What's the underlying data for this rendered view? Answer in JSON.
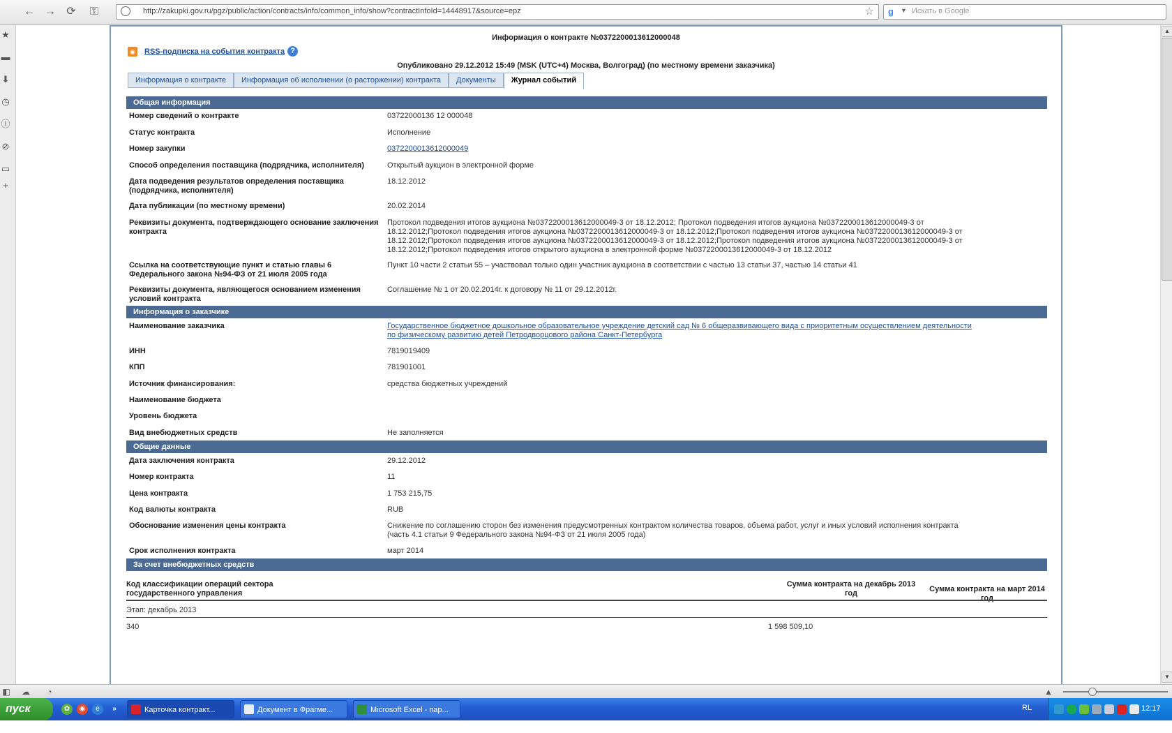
{
  "browser": {
    "url": "http://zakupki.gov.ru/pgz/public/action/contracts/info/common_info/show?contractInfoId=14448917&source=epz",
    "search_placeholder": "Искать в Google"
  },
  "page": {
    "title": "Информация о контракте №0372200013612000048",
    "rss_link": "RSS-подписка на события контракта",
    "rss_help": "?",
    "published": "Опубликовано 29.12.2012 15:49 (MSK (UTC+4) Москва, Волгоград) (по местному времени заказчика)",
    "tabs": [
      {
        "label": "Информация о контракте"
      },
      {
        "label": "Информация об исполнении (о расторжении) контракта"
      },
      {
        "label": "Документы"
      },
      {
        "label": "Журнал событий"
      }
    ]
  },
  "sections": {
    "general": {
      "header": "Общая информация",
      "rows": [
        {
          "label": "Номер сведений о контракте",
          "value": "03722000136 12 000048"
        },
        {
          "label": "Статус контракта",
          "value": "Исполнение"
        },
        {
          "label": "Номер закупки",
          "value": "0372200013612000049"
        },
        {
          "label": "Способ определения поставщика (подрядчика, исполнителя)",
          "value": "Открытый аукцион в электронной форме"
        },
        {
          "label": "Дата подведения результатов определения поставщика (подрядчика, исполнителя)",
          "value": "18.12.2012"
        },
        {
          "label": "Дата публикации (по местному времени)",
          "value": "20.02.2014"
        },
        {
          "label": "Реквизиты документа, подтверждающего основание заключения контракта",
          "value": "Протокол подведения итогов аукциона №0372200013612000049-3 от 18.12.2012; Протокол подведения итогов аукциона №0372200013612000049-3 от 18.12.2012;Протокол подведения итогов аукциона №0372200013612000049-3 от 18.12.2012;Протокол подведения итогов аукциона №0372200013612000049-3 от 18.12.2012;Протокол подведения итогов аукциона №0372200013612000049-3 от 18.12.2012;Протокол подведения итогов аукциона №0372200013612000049-3 от 18.12.2012;Протокол подведения итогов открытого аукциона в электронной форме №0372200013612000049-3 от 18.12.2012"
        },
        {
          "label": "Ссылка на соответствующие пункт и статью главы 6 Федерального закона №94-ФЗ от 21 июля 2005 года",
          "value": "Пункт 10 части 2 статьи 55 – участвовал только один участник аукциона в соответствии с частью 13 статьи 37, частью 14 статьи 41"
        },
        {
          "label": "Реквизиты документа, являющегося основанием изменения условий контракта",
          "value": "Соглашение № 1 от 20.02.2014г. к договору № 11 от 29.12.2012г."
        }
      ]
    },
    "customer": {
      "header": "Информация о заказчике",
      "rows": [
        {
          "label": "Наименование заказчика",
          "value": "Государственное бюджетное дошкольное образовательное учреждение детский сад № 6 общеразвивающего вида с приоритетным осуществлением деятельности по физическому развитию детей Петродворцового района Санкт-Петербурга"
        },
        {
          "label": "ИНН",
          "value": "7819019409"
        },
        {
          "label": "КПП",
          "value": "781901001"
        },
        {
          "label": "Источник финансирования:",
          "value": "средства бюджетных учреждений"
        },
        {
          "label": "Наименование бюджета",
          "value": ""
        },
        {
          "label": "Уровень бюджета",
          "value": ""
        },
        {
          "label": "Вид внебюджетных средств",
          "value": "Не заполняется"
        }
      ]
    },
    "common": {
      "header": "Общие данные",
      "rows": [
        {
          "label": "Дата заключения контракта",
          "value": "29.12.2012"
        },
        {
          "label": "Номер контракта",
          "value": "11"
        },
        {
          "label": "Цена контракта",
          "value": "1 753 215,75"
        },
        {
          "label": "Код валюты контракта",
          "value": "RUB"
        },
        {
          "label": "Обоснование изменения цены контракта",
          "value": "Снижение по соглашению сторон без изменения предусмотренных контрактом количества товаров, объема работ, услуг и иных условий исполнения контракта (часть 4.1 статьи 9 Федерального закона №94-ФЗ от 21 июля 2005 года)"
        },
        {
          "label": "Срок исполнения контракта",
          "value": "март 2014"
        }
      ]
    },
    "extrabudget": {
      "header": "За счет внебюджетных средств",
      "columns": [
        "Код классификации операций сектора государственного управления",
        "Сумма контракта на декабрь 2013 год",
        "Сумма контракта на март 2014 год"
      ],
      "stage": "Этап: декабрь 2013",
      "row": {
        "code": "340",
        "dec2013": "1 598 509,10"
      }
    }
  },
  "taskbar": {
    "start": "пуск",
    "tasks": [
      {
        "label": "Карточка контракт..."
      },
      {
        "label": "Документ в Фрагме..."
      },
      {
        "label": "Microsoft Excel - пар..."
      }
    ],
    "lang": "RL",
    "clock": "12:17"
  }
}
